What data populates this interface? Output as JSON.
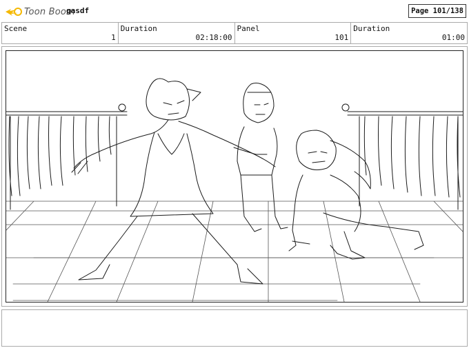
{
  "header": {
    "logo_text": "Toon Boom",
    "project_name": "gasdf",
    "page": "Page 101/138"
  },
  "info": {
    "scene_label": "Scene",
    "scene_value": "1",
    "duration_label": "Duration",
    "duration_value": "02:18:00",
    "panel_label": "Panel",
    "panel_value": "101",
    "panel_duration_label": "Duration",
    "panel_duration_value": "01:00"
  },
  "colors": {
    "logo_accent": "#f5b800",
    "border": "#aaaaaa",
    "sketch": "#1a1a1a"
  },
  "panel": {
    "sketch_description_icon": "storyboard-sketch"
  },
  "notes": {}
}
